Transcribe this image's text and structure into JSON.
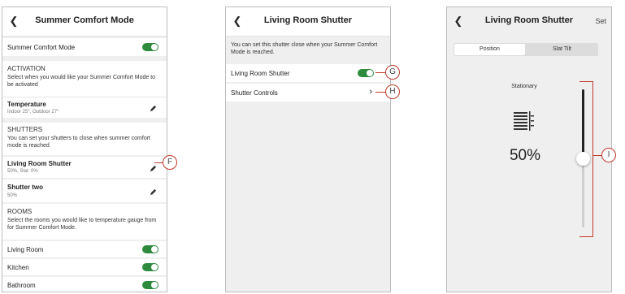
{
  "screen1": {
    "title": "Summer Comfort Mode",
    "summer_comfort_mode_label": "Summer Comfort Mode",
    "activation": {
      "heading": "ACTIVATION",
      "description": "Select when you would like your Summer Comfort Mode to be activated"
    },
    "temperature": {
      "title": "Temperature",
      "detail": "Indoor 25°, Outdoor 27°"
    },
    "shutters": {
      "heading": "SHUTTERS",
      "description": "You can set your shutters to close when summer comfort mode is reached",
      "items": [
        {
          "name": "Living Room Shutter",
          "detail": "50%, Slat: 0%"
        },
        {
          "name": "Shutter two",
          "detail": "50%"
        }
      ]
    },
    "rooms": {
      "heading": "ROOMS",
      "description": "Select the rooms you would like to temperature gauge from for Summer Comfort Mode.",
      "items": [
        "Living Room",
        "Kitchen",
        "Bathroom"
      ]
    },
    "callout": "F"
  },
  "screen2": {
    "title": "Living Room Shutter",
    "description": "You can set this shutter close when your Summer Comfort Mode is reached.",
    "toggle_label": "Living Room Shutter",
    "controls_label": "Shutter Controls",
    "callout_toggle": "G",
    "callout_controls": "H"
  },
  "screen3": {
    "title": "Living Room Shutter",
    "set_label": "Set",
    "tabs": [
      "Position",
      "Slat Tilt"
    ],
    "status": "Stationary",
    "percent": "50%",
    "slider_level": 0.5,
    "callout": "I"
  },
  "colors": {
    "toggle_on": "#2e8b3e",
    "callout": "#c0392b",
    "background": "#efefef"
  }
}
